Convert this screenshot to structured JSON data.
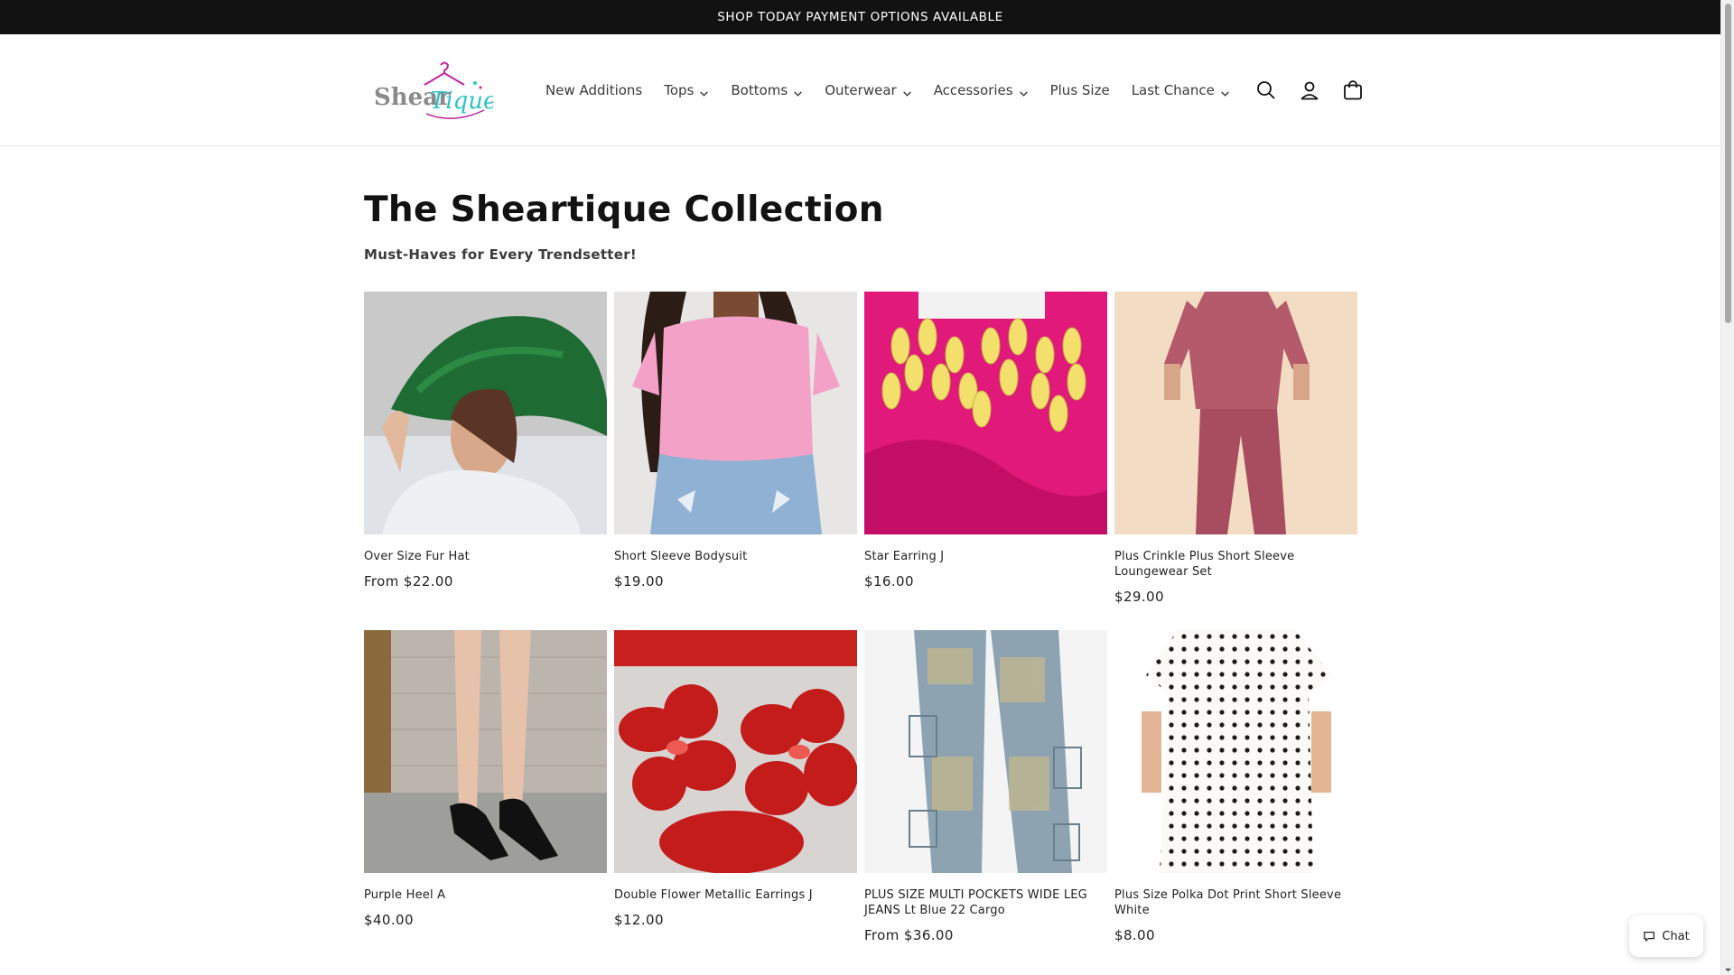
{
  "announcement": "SHOP TODAY PAYMENT OPTIONS AVAILABLE",
  "logo": {
    "text_main": "Shear",
    "text_accent": "Tique"
  },
  "nav": [
    {
      "label": "New Additions",
      "dropdown": false
    },
    {
      "label": "Tops",
      "dropdown": true
    },
    {
      "label": "Bottoms",
      "dropdown": true
    },
    {
      "label": "Outerwear",
      "dropdown": true
    },
    {
      "label": "Accessories",
      "dropdown": true
    },
    {
      "label": "Plus Size",
      "dropdown": false
    },
    {
      "label": "Last Chance",
      "dropdown": true
    }
  ],
  "header_icons": [
    "search-icon",
    "account-icon",
    "cart-icon"
  ],
  "collection": {
    "title": "The Sheartique Collection",
    "subtitle": "Must-Haves for Every Trendsetter!"
  },
  "products": [
    {
      "name": "Over Size Fur Hat",
      "price": "From $22.00",
      "image": "green-fur-hat"
    },
    {
      "name": "Short Sleeve Bodysuit",
      "price": "$19.00",
      "image": "pink-bodysuit"
    },
    {
      "name": "Star Earring J",
      "price": "$16.00",
      "image": "yellow-star-earring"
    },
    {
      "name": "Plus Crinkle Plus Short Sleeve Loungewear Set",
      "price": "$29.00",
      "image": "rose-loungewear"
    },
    {
      "name": "Purple Heel A",
      "price": "$40.00",
      "image": "black-heels"
    },
    {
      "name": "Double Flower Metallic Earrings J",
      "price": "$12.00",
      "image": "red-flower-earrings"
    },
    {
      "name": "PLUS SIZE MULTI POCKETS WIDE LEG JEANS Lt Blue 22 Cargo",
      "price": "From $36.00",
      "image": "cargo-jeans"
    },
    {
      "name": "Plus Size Polka Dot Print Short Sleeve White",
      "price": "$8.00",
      "image": "polka-dot-dress"
    }
  ],
  "chat": {
    "label": "Chat"
  },
  "colors": {
    "announcement_bg": "#121212",
    "text": "#121212",
    "logo_pink": "#c2249b",
    "logo_teal": "#2ec4c6"
  }
}
